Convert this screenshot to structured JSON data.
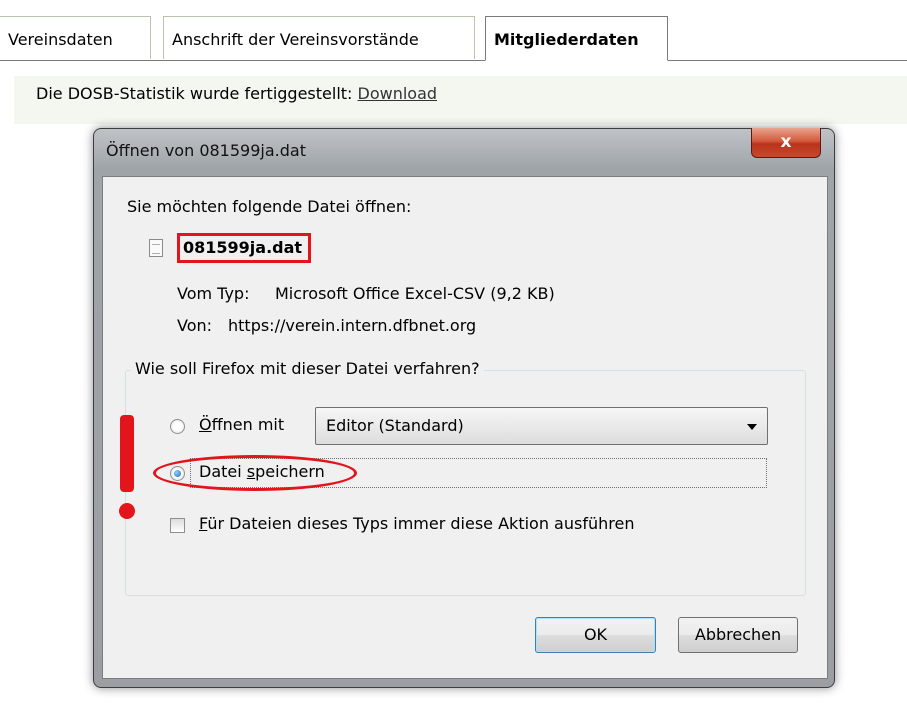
{
  "tabs": [
    {
      "label": "Vereinsdaten"
    },
    {
      "label": "Anschrift der Vereinsvorstände"
    },
    {
      "label": "Mitgliederdaten"
    }
  ],
  "notice": {
    "text": "Die DOSB-Statistik wurde fertiggestellt: ",
    "link": "Download"
  },
  "dialog": {
    "title": "Öffnen von 081599ja.dat",
    "close_label": "x",
    "prompt": "Sie möchten folgende Datei öffnen:",
    "filename": "081599ja.dat",
    "type_label": "Vom Typ:",
    "type_value": "Microsoft Office Excel-CSV (9,2 KB)",
    "from_label": "Von:",
    "from_value": "https://verein.intern.dfbnet.org",
    "group_title": "Wie soll Firefox mit dieser Datei verfahren?",
    "open_with": {
      "mnemonic": "Ö",
      "rest": "ffnen mit",
      "selected": false
    },
    "app_select": {
      "value": "Editor (Standard)"
    },
    "save_file": {
      "pre": "Datei ",
      "mnemonic": "s",
      "rest": "peichern",
      "selected": true
    },
    "always": {
      "mnemonic": "F",
      "rest": "ür Dateien dieses Typs immer diese Aktion ausführen",
      "checked": false
    },
    "ok_label": "OK",
    "cancel_label": "Abbrechen"
  },
  "colors": {
    "annotation": "#e3141b",
    "notice_bg": "#f3f7ef",
    "close_button": "#c8482b"
  }
}
